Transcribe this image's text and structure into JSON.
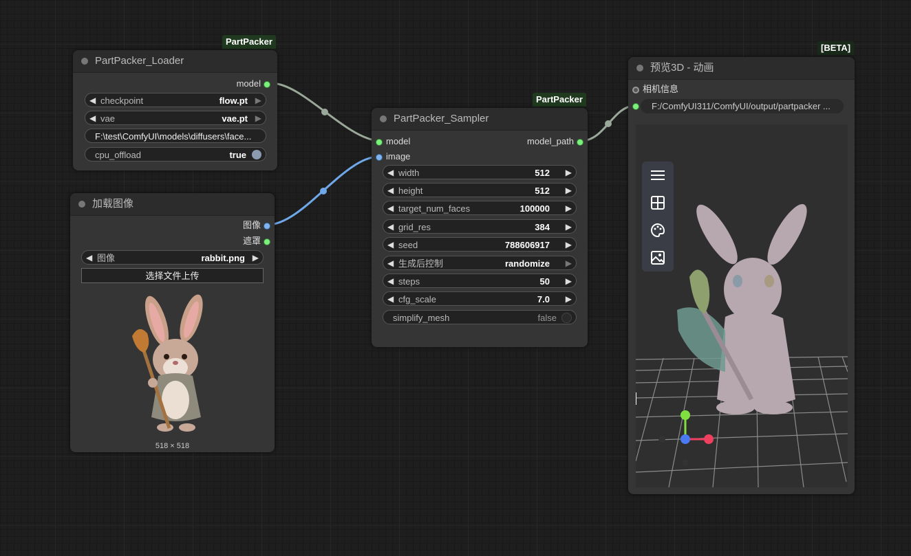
{
  "badges": {
    "loader": "PartPacker",
    "sampler": "PartPacker",
    "preview": "[BETA]"
  },
  "loader": {
    "title": "PartPacker_Loader",
    "output_model": "model",
    "checkpoint": {
      "label": "checkpoint",
      "value": "flow.pt"
    },
    "vae": {
      "label": "vae",
      "value": "vae.pt"
    },
    "path": "F:\\test\\ComfyUI\\models\\diffusers\\face...",
    "cpu_offload": {
      "label": "cpu_offload",
      "value": "true"
    }
  },
  "load_image": {
    "title": "加载图像",
    "output_image": "图像",
    "output_mask": "遮罩",
    "image_widget": {
      "label": "图像",
      "value": "rabbit.png"
    },
    "upload_label": "选择文件上传",
    "image_size": "518 × 518"
  },
  "sampler": {
    "title": "PartPacker_Sampler",
    "input_model": "model",
    "input_image": "image",
    "output_model_path": "model_path",
    "widgets": [
      {
        "label": "width",
        "value": "512"
      },
      {
        "label": "height",
        "value": "512"
      },
      {
        "label": "target_num_faces",
        "value": "100000"
      },
      {
        "label": "grid_res",
        "value": "384"
      },
      {
        "label": "seed",
        "value": "788606917"
      },
      {
        "label": "生成后控制",
        "value": "randomize"
      },
      {
        "label": "steps",
        "value": "50"
      },
      {
        "label": "cfg_scale",
        "value": "7.0"
      }
    ],
    "simplify_mesh": {
      "label": "simplify_mesh",
      "value": "false"
    }
  },
  "preview": {
    "title": "预览3D - 动画",
    "input_camera": "相机信息",
    "model_file": "F:/ComfyUI311/ComfyUI/output/partpacker ...",
    "toolbar": [
      "menu-icon",
      "layout-grid-icon",
      "palette-icon",
      "image-icon"
    ]
  },
  "colors": {
    "link_model": "#9aa89a",
    "link_image": "#6fa8e8",
    "slot_green": "#7cf07c",
    "slot_blue": "#7fb4f0"
  }
}
